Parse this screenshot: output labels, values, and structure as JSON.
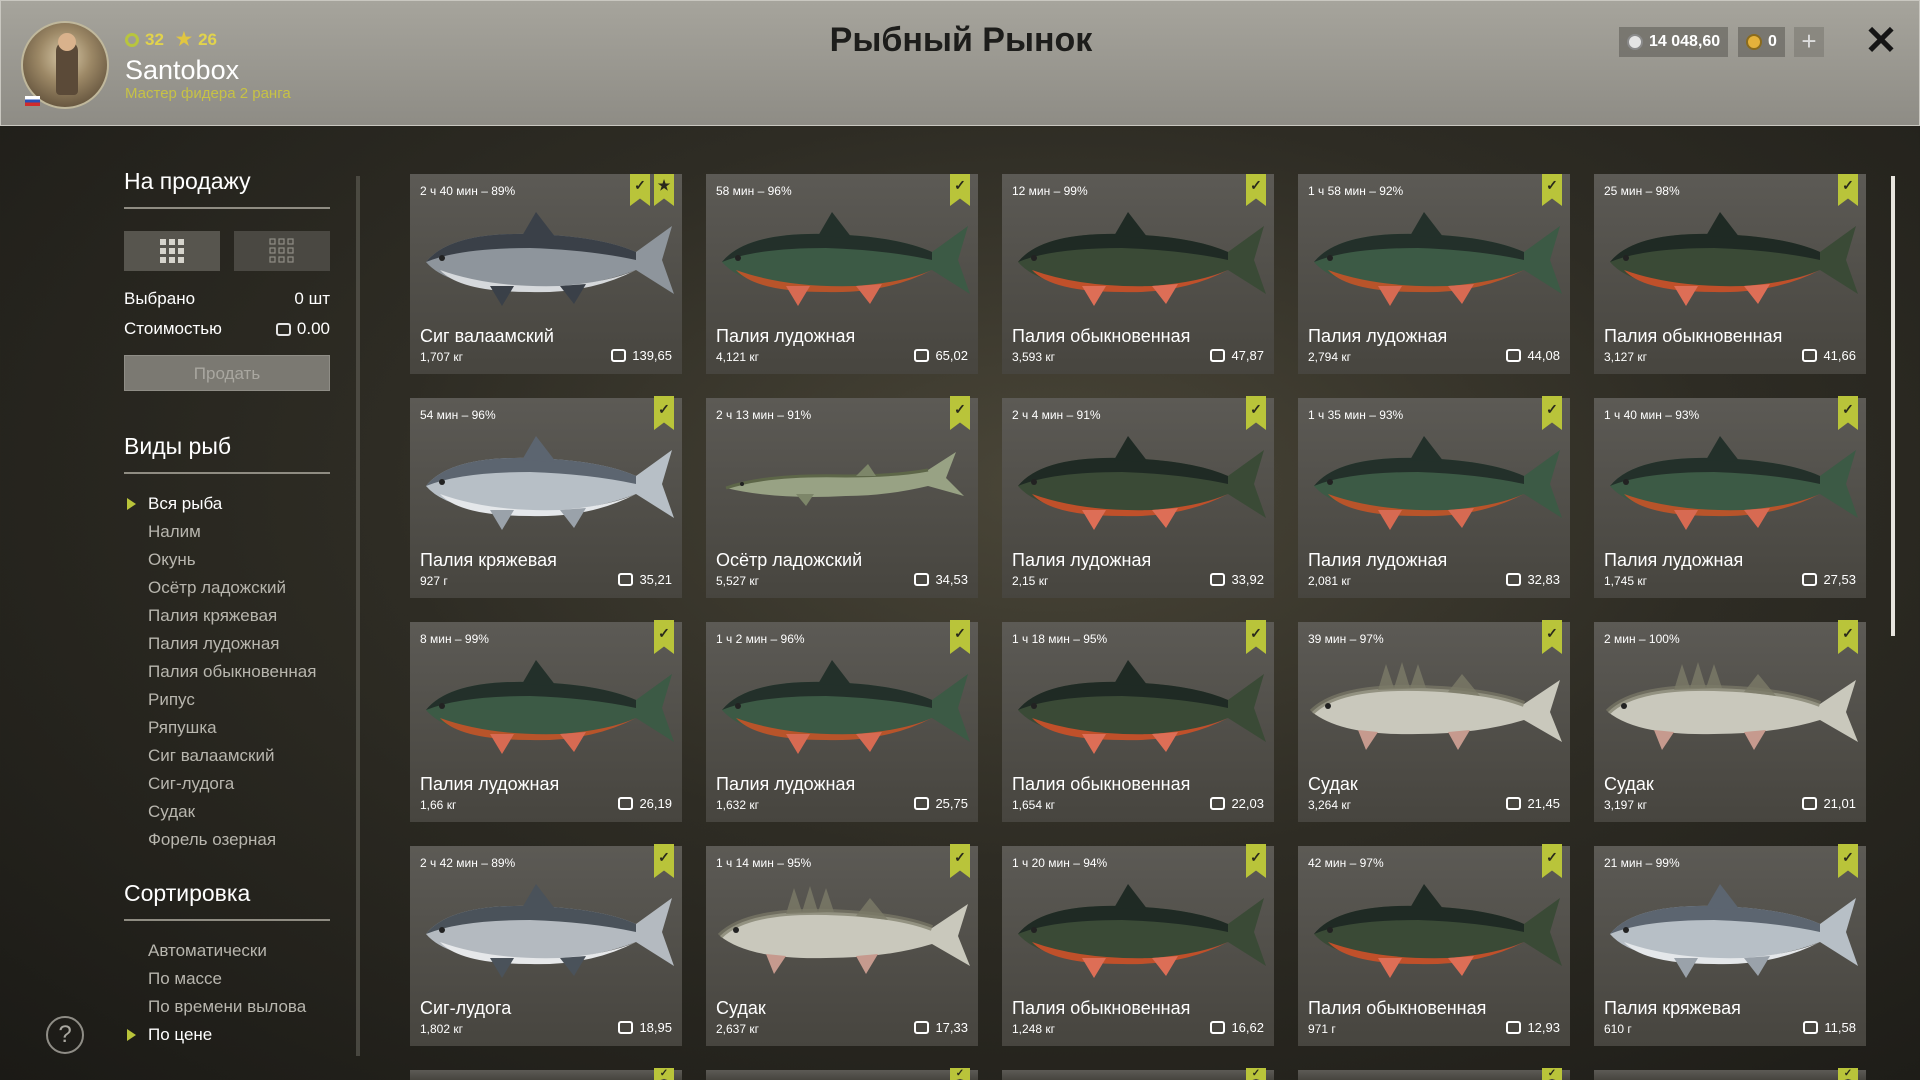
{
  "header": {
    "title": "Рыбный Рынок",
    "level": "32",
    "stars": "26",
    "username": "Santobox",
    "rank": "Мастер фидера 2 ранга",
    "silver": "14 048,60",
    "gold": "0",
    "plus": "+",
    "close": "✕"
  },
  "sidebar": {
    "for_sale_title": "На продажу",
    "selected_label": "Выбрано",
    "selected_value": "0 шт",
    "cost_label": "Стоимостью",
    "cost_value": "0.00",
    "sell_button": "Продать",
    "fish_types_title": "Виды рыб",
    "fish_types": [
      "Вся рыба",
      "Налим",
      "Окунь",
      "Осётр ладожский",
      "Палия кряжевая",
      "Палия лудожная",
      "Палия обыкновенная",
      "Рипус",
      "Ряпушка",
      "Сиг валаамский",
      "Сиг-лудога",
      "Судак",
      "Форель озерная"
    ],
    "sort_title": "Сортировка",
    "sort_options": [
      "Автоматически",
      "По массе",
      "По времени вылова",
      "По цене"
    ],
    "help": "?"
  },
  "colors": {
    "accent": "#b9c43a",
    "gold_text": "#e1d34c"
  },
  "cards": [
    {
      "time": "2 ч 40 мин – 89%",
      "name": "Сиг валаамский",
      "weight": "1,707 кг",
      "price": "139,65",
      "fish": "whitefish",
      "star": true
    },
    {
      "time": "58 мин – 96%",
      "name": "Палия лудожная",
      "weight": "4,121 кг",
      "price": "65,02",
      "fish": "char"
    },
    {
      "time": "12 мин – 99%",
      "name": "Палия обыкновенная",
      "weight": "3,593 кг",
      "price": "47,87",
      "fish": "char-red"
    },
    {
      "time": "1 ч 58 мин – 92%",
      "name": "Палия лудожная",
      "weight": "2,794 кг",
      "price": "44,08",
      "fish": "char"
    },
    {
      "time": "25 мин – 98%",
      "name": "Палия обыкновенная",
      "weight": "3,127 кг",
      "price": "41,66",
      "fish": "char-red"
    },
    {
      "time": "54 мин – 96%",
      "name": "Палия кряжевая",
      "weight": "927 г",
      "price": "35,21",
      "fish": "silver"
    },
    {
      "time": "2 ч 13 мин – 91%",
      "name": "Осётр ладожский",
      "weight": "5,527 кг",
      "price": "34,53",
      "fish": "sturgeon"
    },
    {
      "time": "2 ч 4 мин – 91%",
      "name": "Палия лудожная",
      "weight": "2,15 кг",
      "price": "33,92",
      "fish": "char-red"
    },
    {
      "time": "1 ч 35 мин – 93%",
      "name": "Палия лудожная",
      "weight": "2,081 кг",
      "price": "32,83",
      "fish": "char"
    },
    {
      "time": "1 ч 40 мин – 93%",
      "name": "Палия лудожная",
      "weight": "1,745 кг",
      "price": "27,53",
      "fish": "char"
    },
    {
      "time": "8 мин – 99%",
      "name": "Палия лудожная",
      "weight": "1,66 кг",
      "price": "26,19",
      "fish": "char"
    },
    {
      "time": "1 ч 2 мин – 96%",
      "name": "Палия лудожная",
      "weight": "1,632 кг",
      "price": "25,75",
      "fish": "char"
    },
    {
      "time": "1 ч 18 мин – 95%",
      "name": "Палия обыкновенная",
      "weight": "1,654 кг",
      "price": "22,03",
      "fish": "char-red"
    },
    {
      "time": "39 мин – 97%",
      "name": "Судак",
      "weight": "3,264 кг",
      "price": "21,45",
      "fish": "zander"
    },
    {
      "time": "2 мин – 100%",
      "name": "Судак",
      "weight": "3,197 кг",
      "price": "21,01",
      "fish": "zander"
    },
    {
      "time": "2 ч 42 мин – 89%",
      "name": "Сиг-лудога",
      "weight": "1,802 кг",
      "price": "18,95",
      "fish": "whitefish-silver"
    },
    {
      "time": "1 ч 14 мин – 95%",
      "name": "Судак",
      "weight": "2,637 кг",
      "price": "17,33",
      "fish": "zander"
    },
    {
      "time": "1 ч 20 мин – 94%",
      "name": "Палия обыкновенная",
      "weight": "1,248 кг",
      "price": "16,62",
      "fish": "char-red"
    },
    {
      "time": "42 мин – 97%",
      "name": "Палия обыкновенная",
      "weight": "971 г",
      "price": "12,93",
      "fish": "char-red"
    },
    {
      "time": "21 мин – 99%",
      "name": "Палия кряжевая",
      "weight": "610 г",
      "price": "11,58",
      "fish": "silver"
    }
  ]
}
